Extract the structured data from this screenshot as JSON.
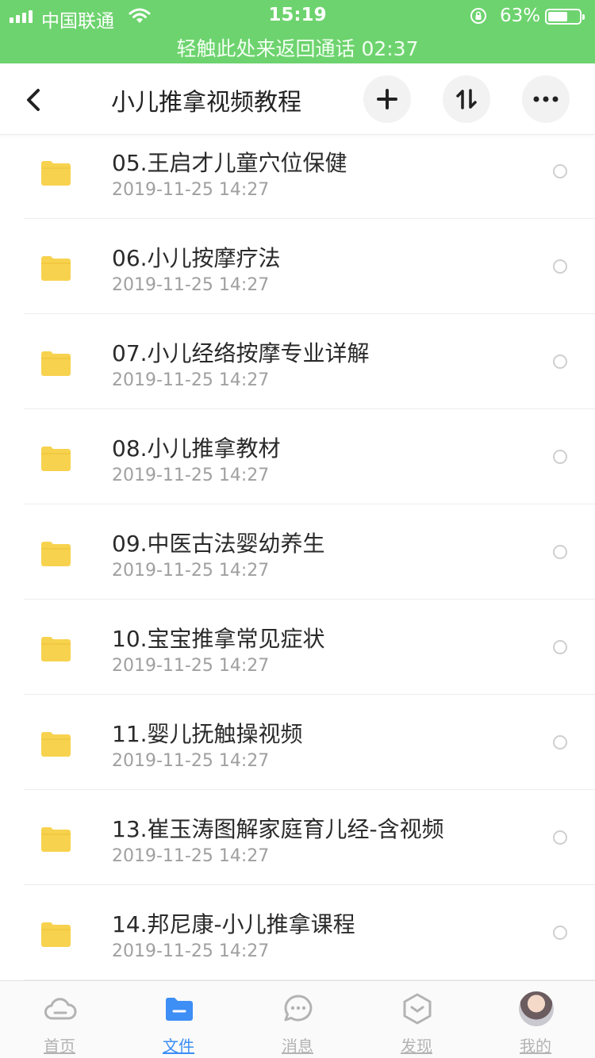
{
  "status_bar": {
    "carrier": "中国联通",
    "time": "15:19",
    "battery_percent": "63%",
    "battery_level": 0.63,
    "call_banner": "轻触此处来返回通话 02:37",
    "background_color": "#6dd36e"
  },
  "nav": {
    "title": "小儿推拿视频教程",
    "buttons": [
      "add-icon",
      "sort-icon",
      "more-icon"
    ]
  },
  "files": [
    {
      "name": "05.王启才儿童穴位保健",
      "date": "2019-11-25 14:27"
    },
    {
      "name": "06.小儿按摩疗法",
      "date": "2019-11-25 14:27"
    },
    {
      "name": "07.小儿经络按摩专业详解",
      "date": "2019-11-25 14:27"
    },
    {
      "name": "08.小儿推拿教材",
      "date": "2019-11-25 14:27"
    },
    {
      "name": "09.中医古法婴幼养生",
      "date": "2019-11-25 14:27"
    },
    {
      "name": "10.宝宝推拿常见症状",
      "date": "2019-11-25 14:27"
    },
    {
      "name": "11.婴儿抚触操视频",
      "date": "2019-11-25 14:27"
    },
    {
      "name": "13.崔玉涛图解家庭育儿经-含视频",
      "date": "2019-11-25 14:27"
    },
    {
      "name": "14.邦尼康-小儿推拿课程",
      "date": "2019-11-25 14:27"
    }
  ],
  "tabs": [
    {
      "label": "首页",
      "icon": "cloud-icon"
    },
    {
      "label": "文件",
      "icon": "folder-icon",
      "active": true
    },
    {
      "label": "消息",
      "icon": "chat-icon"
    },
    {
      "label": "发现",
      "icon": "discover-icon"
    },
    {
      "label": "我的",
      "icon": "avatar"
    }
  ],
  "colors": {
    "accent": "#3d8ef5",
    "folder": "#f7d24e",
    "status_green": "#6dd36e"
  }
}
